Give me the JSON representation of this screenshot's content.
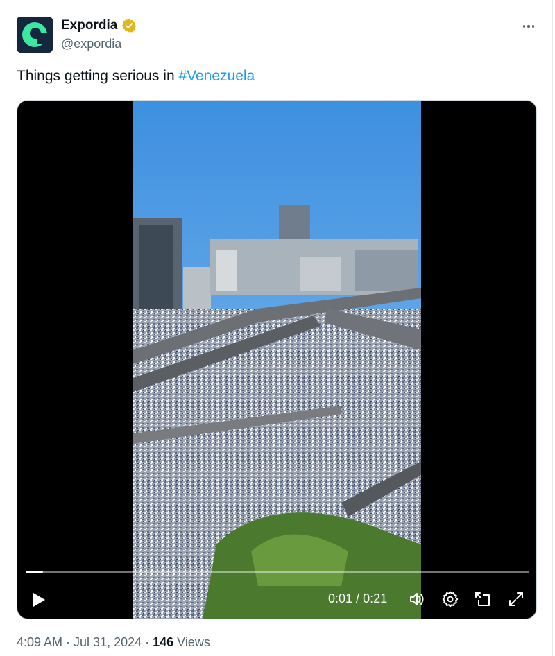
{
  "author": {
    "display_name": "Expordia",
    "handle": "@expordia",
    "avatar_icon": "expordia-logo",
    "verified_icon": "gold-verified-badge",
    "verified_color": "#e2b719",
    "avatar_bg": "#14273d",
    "avatar_accent": "#3be8a2"
  },
  "more_icon": "more-horizontal-icon",
  "tweet": {
    "text_prefix": "Things getting serious in ",
    "hashtag": "#Venezuela",
    "hashtag_color": "#1d9bf0"
  },
  "video": {
    "elapsed": "0:01",
    "separator": " / ",
    "duration": "0:21",
    "progress_fraction": 0.034,
    "controls": {
      "play_icon": "play-icon",
      "volume_icon": "volume-icon",
      "settings_icon": "settings-gear-icon",
      "pip_icon": "picture-in-picture-icon",
      "fullscreen_icon": "fullscreen-expand-icon"
    }
  },
  "meta": {
    "time": "4:09 AM",
    "dot1": " · ",
    "date": "Jul 31, 2024",
    "dot2": " · ",
    "views_count": "146",
    "views_label": " Views"
  }
}
